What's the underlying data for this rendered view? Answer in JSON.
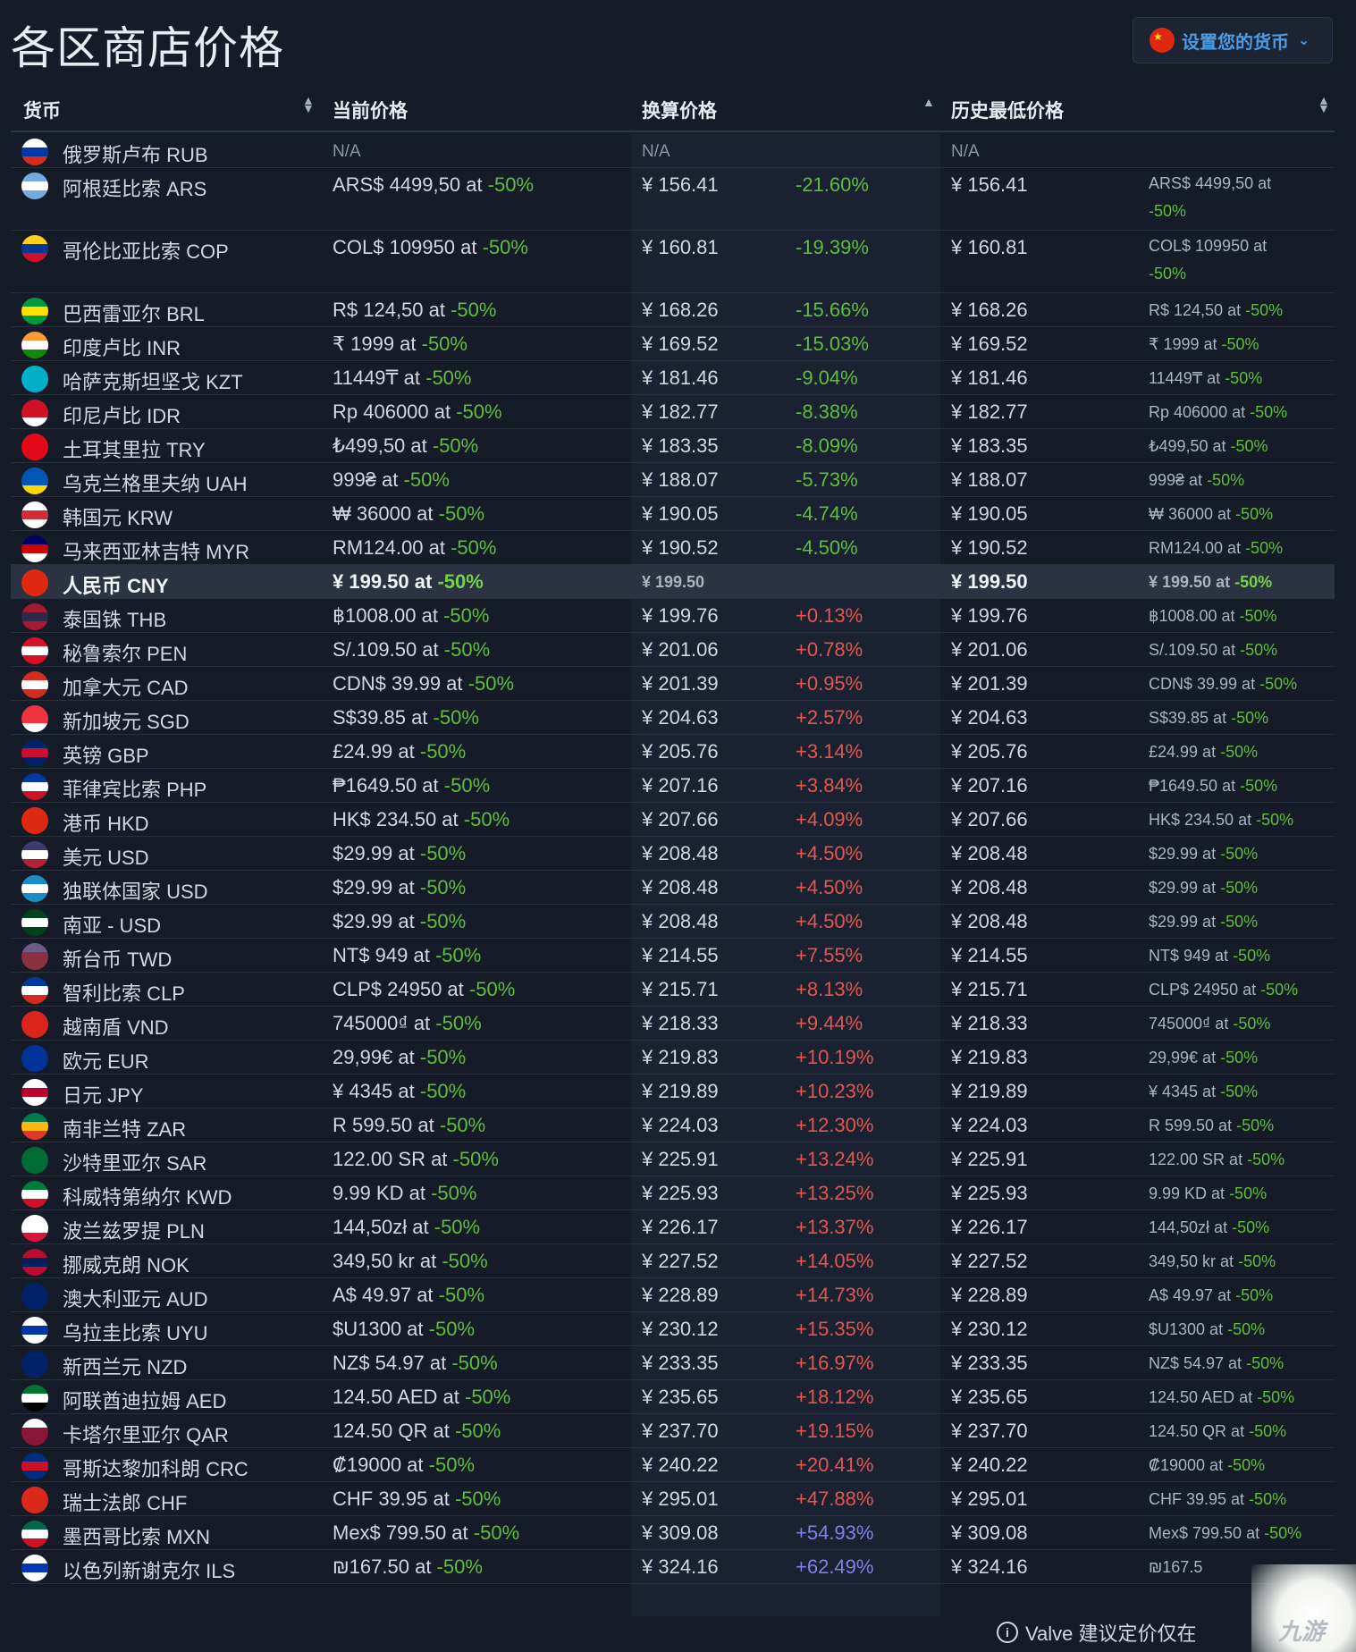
{
  "title": "各区商店价格",
  "currency_button": "设置您的货币",
  "columns": {
    "currency": "货币",
    "current": "当前价格",
    "converted": "换算价格",
    "lowest": "历史最低价格"
  },
  "footer": "Valve 建议定价仅在",
  "watermark": "九游",
  "rows": [
    {
      "name": "俄罗斯卢布 RUB",
      "cur": "N/A",
      "conv": "N/A",
      "pct": "",
      "low": "N/A",
      "low_p": "",
      "low_d": "",
      "na": true,
      "colors": [
        "#ffffff",
        "#0039a6",
        "#d52b1e"
      ]
    },
    {
      "name": "阿根廷比索 ARS",
      "cur_p": "ARS$ 4499,50 at ",
      "cur_d": "-50%",
      "conv": "¥ 156.41",
      "pct": "-21.60%",
      "low": "¥ 156.41",
      "low_p": "ARS$ 4499,50 at ",
      "low_d": "-50%",
      "tall": true,
      "colors": [
        "#74acdf",
        "#ffffff",
        "#74acdf"
      ]
    },
    {
      "name": "哥伦比亚比索 COP",
      "cur_p": "COL$ 109950 at ",
      "cur_d": "-50%",
      "conv": "¥ 160.81",
      "pct": "-19.39%",
      "low": "¥ 160.81",
      "low_p": "COL$ 109950 at ",
      "low_d": "-50%",
      "tall": true,
      "colors": [
        "#fcd116",
        "#003893",
        "#ce1126"
      ]
    },
    {
      "name": "巴西雷亚尔 BRL",
      "cur_p": "R$ 124,50 at ",
      "cur_d": "-50%",
      "conv": "¥ 168.26",
      "pct": "-15.66%",
      "low": "¥ 168.26",
      "low_p": "R$ 124,50 at ",
      "low_d": "-50%",
      "colors": [
        "#009c3b",
        "#ffdf00",
        "#009c3b"
      ]
    },
    {
      "name": "印度卢比 INR",
      "cur_p": "₹ 1999 at ",
      "cur_d": "-50%",
      "conv": "¥ 169.52",
      "pct": "-15.03%",
      "low": "¥ 169.52",
      "low_p": "₹ 1999 at ",
      "low_d": "-50%",
      "colors": [
        "#ff9933",
        "#ffffff",
        "#138808"
      ]
    },
    {
      "name": "哈萨克斯坦坚戈 KZT",
      "cur_p": "11449₸ at ",
      "cur_d": "-50%",
      "conv": "¥ 181.46",
      "pct": "-9.04%",
      "low": "¥ 181.46",
      "low_p": "11449₸ at ",
      "low_d": "-50%",
      "colors": [
        "#00afca",
        "#00afca",
        "#00afca"
      ]
    },
    {
      "name": "印尼卢比 IDR",
      "cur_p": "Rp 406000 at ",
      "cur_d": "-50%",
      "conv": "¥ 182.77",
      "pct": "-8.38%",
      "low": "¥ 182.77",
      "low_p": "Rp 406000 at ",
      "low_d": "-50%",
      "colors": [
        "#ce1126",
        "#ce1126",
        "#ffffff"
      ]
    },
    {
      "name": "土耳其里拉 TRY",
      "cur_p": "₺499,50 at ",
      "cur_d": "-50%",
      "conv": "¥ 183.35",
      "pct": "-8.09%",
      "low": "¥ 183.35",
      "low_p": "₺499,50 at ",
      "low_d": "-50%",
      "colors": [
        "#e30a17",
        "#e30a17",
        "#e30a17"
      ]
    },
    {
      "name": "乌克兰格里夫纳 UAH",
      "cur_p": "999₴ at ",
      "cur_d": "-50%",
      "conv": "¥ 188.07",
      "pct": "-5.73%",
      "low": "¥ 188.07",
      "low_p": "999₴ at ",
      "low_d": "-50%",
      "colors": [
        "#0057b7",
        "#0057b7",
        "#ffd700"
      ]
    },
    {
      "name": "韩国元 KRW",
      "cur_p": "₩ 36000 at ",
      "cur_d": "-50%",
      "conv": "¥ 190.05",
      "pct": "-4.74%",
      "low": "¥ 190.05",
      "low_p": "₩ 36000 at ",
      "low_d": "-50%",
      "colors": [
        "#ffffff",
        "#cd2e3a",
        "#ffffff"
      ]
    },
    {
      "name": "马来西亚林吉特 MYR",
      "cur_p": "RM124.00 at ",
      "cur_d": "-50%",
      "conv": "¥ 190.52",
      "pct": "-4.50%",
      "low": "¥ 190.52",
      "low_p": "RM124.00 at ",
      "low_d": "-50%",
      "colors": [
        "#010066",
        "#cc0001",
        "#ffffff"
      ]
    },
    {
      "name": "人民币 CNY",
      "cur_p": "¥ 199.50 at ",
      "cur_d": "-50%",
      "conv": "¥ 199.50",
      "pct": "",
      "low": "¥ 199.50",
      "low_p": "¥ 199.50 at ",
      "low_d": "-50%",
      "hl": true,
      "colors": [
        "#de2910",
        "#de2910",
        "#de2910"
      ]
    },
    {
      "name": "泰国铢 THB",
      "cur_p": "฿1008.00 at ",
      "cur_d": "-50%",
      "conv": "¥ 199.76",
      "pct": "+0.13%",
      "low": "¥ 199.76",
      "low_p": "฿1008.00 at ",
      "low_d": "-50%",
      "colors": [
        "#a51931",
        "#2d2a4a",
        "#a51931"
      ]
    },
    {
      "name": "秘鲁索尔 PEN",
      "cur_p": "S/.109.50 at ",
      "cur_d": "-50%",
      "conv": "¥ 201.06",
      "pct": "+0.78%",
      "low": "¥ 201.06",
      "low_p": "S/.109.50 at ",
      "low_d": "-50%",
      "colors": [
        "#d91023",
        "#ffffff",
        "#d91023"
      ]
    },
    {
      "name": "加拿大元 CAD",
      "cur_p": "CDN$ 39.99 at ",
      "cur_d": "-50%",
      "conv": "¥ 201.39",
      "pct": "+0.95%",
      "low": "¥ 201.39",
      "low_p": "CDN$ 39.99 at ",
      "low_d": "-50%",
      "colors": [
        "#d52b1e",
        "#ffffff",
        "#d52b1e"
      ]
    },
    {
      "name": "新加坡元 SGD",
      "cur_p": "S$39.85 at ",
      "cur_d": "-50%",
      "conv": "¥ 204.63",
      "pct": "+2.57%",
      "low": "¥ 204.63",
      "low_p": "S$39.85 at ",
      "low_d": "-50%",
      "colors": [
        "#ef3340",
        "#ef3340",
        "#ffffff"
      ]
    },
    {
      "name": "英镑 GBP",
      "cur_p": "£24.99 at ",
      "cur_d": "-50%",
      "conv": "¥ 205.76",
      "pct": "+3.14%",
      "low": "¥ 205.76",
      "low_p": "£24.99 at ",
      "low_d": "-50%",
      "colors": [
        "#012169",
        "#c8102e",
        "#012169"
      ]
    },
    {
      "name": "菲律宾比索 PHP",
      "cur_p": "₱1649.50 at ",
      "cur_d": "-50%",
      "conv": "¥ 207.16",
      "pct": "+3.84%",
      "low": "¥ 207.16",
      "low_p": "₱1649.50 at ",
      "low_d": "-50%",
      "colors": [
        "#0038a8",
        "#ffffff",
        "#ce1126"
      ]
    },
    {
      "name": "港币 HKD",
      "cur_p": "HK$ 234.50 at ",
      "cur_d": "-50%",
      "conv": "¥ 207.66",
      "pct": "+4.09%",
      "low": "¥ 207.66",
      "low_p": "HK$ 234.50 at ",
      "low_d": "-50%",
      "colors": [
        "#de2910",
        "#de2910",
        "#de2910"
      ]
    },
    {
      "name": "美元 USD",
      "cur_p": "$29.99 at ",
      "cur_d": "-50%",
      "conv": "¥ 208.48",
      "pct": "+4.50%",
      "low": "¥ 208.48",
      "low_p": "$29.99 at ",
      "low_d": "-50%",
      "colors": [
        "#3c3b6e",
        "#ffffff",
        "#b22234"
      ]
    },
    {
      "name": "独联体国家 USD",
      "cur_p": "$29.99 at ",
      "cur_d": "-50%",
      "conv": "¥ 208.48",
      "pct": "+4.50%",
      "low": "¥ 208.48",
      "low_p": "$29.99 at ",
      "low_d": "-50%",
      "colors": [
        "#1b8dc6",
        "#ffffff",
        "#1b8dc6"
      ]
    },
    {
      "name": "南亚 - USD",
      "cur_p": "$29.99 at ",
      "cur_d": "-50%",
      "conv": "¥ 208.48",
      "pct": "+4.50%",
      "low": "¥ 208.48",
      "low_p": "$29.99 at ",
      "low_d": "-50%",
      "colors": [
        "#01411c",
        "#ffffff",
        "#01411c"
      ]
    },
    {
      "name": "新台币 TWD",
      "cur_p": "NT$ 949 at ",
      "cur_d": "-50%",
      "conv": "¥ 214.55",
      "pct": "+7.55%",
      "low": "¥ 214.55",
      "low_p": "NT$ 949 at ",
      "low_d": "-50%",
      "colors": [
        "#6b5a8a",
        "#8a3040",
        "#8a3040"
      ]
    },
    {
      "name": "智利比索 CLP",
      "cur_p": "CLP$ 24950 at ",
      "cur_d": "-50%",
      "conv": "¥ 215.71",
      "pct": "+8.13%",
      "low": "¥ 215.71",
      "low_p": "CLP$ 24950 at ",
      "low_d": "-50%",
      "colors": [
        "#0039a6",
        "#ffffff",
        "#d52b1e"
      ]
    },
    {
      "name": "越南盾 VND",
      "cur_p": "745000₫ at ",
      "cur_d": "-50%",
      "conv": "¥ 218.33",
      "pct": "+9.44%",
      "low": "¥ 218.33",
      "low_p": "745000₫ at ",
      "low_d": "-50%",
      "colors": [
        "#da251d",
        "#da251d",
        "#da251d"
      ]
    },
    {
      "name": "欧元 EUR",
      "cur_p": "29,99€ at ",
      "cur_d": "-50%",
      "conv": "¥ 219.83",
      "pct": "+10.19%",
      "low": "¥ 219.83",
      "low_p": "29,99€ at ",
      "low_d": "-50%",
      "colors": [
        "#003399",
        "#003399",
        "#003399"
      ]
    },
    {
      "name": "日元 JPY",
      "cur_p": "¥ 4345 at ",
      "cur_d": "-50%",
      "conv": "¥ 219.89",
      "pct": "+10.23%",
      "low": "¥ 219.89",
      "low_p": "¥ 4345 at ",
      "low_d": "-50%",
      "colors": [
        "#ffffff",
        "#bc002d",
        "#ffffff"
      ]
    },
    {
      "name": "南非兰特 ZAR",
      "cur_p": "R 599.50 at ",
      "cur_d": "-50%",
      "conv": "¥ 224.03",
      "pct": "+12.30%",
      "low": "¥ 224.03",
      "low_p": "R 599.50 at ",
      "low_d": "-50%",
      "colors": [
        "#007a4d",
        "#ffb612",
        "#de3831"
      ]
    },
    {
      "name": "沙特里亚尔 SAR",
      "cur_p": "122.00 SR at ",
      "cur_d": "-50%",
      "conv": "¥ 225.91",
      "pct": "+13.24%",
      "low": "¥ 225.91",
      "low_p": "122.00 SR at ",
      "low_d": "-50%",
      "colors": [
        "#006c35",
        "#006c35",
        "#006c35"
      ]
    },
    {
      "name": "科威特第纳尔 KWD",
      "cur_p": "9.99 KD at ",
      "cur_d": "-50%",
      "conv": "¥ 225.93",
      "pct": "+13.25%",
      "low": "¥ 225.93",
      "low_p": "9.99 KD at ",
      "low_d": "-50%",
      "colors": [
        "#007a3d",
        "#ffffff",
        "#ce1126"
      ]
    },
    {
      "name": "波兰兹罗提 PLN",
      "cur_p": "144,50zł at ",
      "cur_d": "-50%",
      "conv": "¥ 226.17",
      "pct": "+13.37%",
      "low": "¥ 226.17",
      "low_p": "144,50zł at ",
      "low_d": "-50%",
      "colors": [
        "#ffffff",
        "#ffffff",
        "#dc143c"
      ]
    },
    {
      "name": "挪威克朗 NOK",
      "cur_p": "349,50 kr at ",
      "cur_d": "-50%",
      "conv": "¥ 227.52",
      "pct": "+14.05%",
      "low": "¥ 227.52",
      "low_p": "349,50 kr at ",
      "low_d": "-50%",
      "colors": [
        "#ba0c2f",
        "#00205b",
        "#ba0c2f"
      ]
    },
    {
      "name": "澳大利亚元 AUD",
      "cur_p": "A$ 49.97 at ",
      "cur_d": "-50%",
      "conv": "¥ 228.89",
      "pct": "+14.73%",
      "low": "¥ 228.89",
      "low_p": "A$ 49.97 at ",
      "low_d": "-50%",
      "colors": [
        "#012169",
        "#012169",
        "#012169"
      ]
    },
    {
      "name": "乌拉圭比索 UYU",
      "cur_p": "$U1300 at ",
      "cur_d": "-50%",
      "conv": "¥ 230.12",
      "pct": "+15.35%",
      "low": "¥ 230.12",
      "low_p": "$U1300 at ",
      "low_d": "-50%",
      "colors": [
        "#ffffff",
        "#0038a8",
        "#ffffff"
      ]
    },
    {
      "name": "新西兰元 NZD",
      "cur_p": "NZ$ 54.97 at ",
      "cur_d": "-50%",
      "conv": "¥ 233.35",
      "pct": "+16.97%",
      "low": "¥ 233.35",
      "low_p": "NZ$ 54.97 at ",
      "low_d": "-50%",
      "colors": [
        "#012169",
        "#012169",
        "#012169"
      ]
    },
    {
      "name": "阿联酋迪拉姆 AED",
      "cur_p": "124.50 AED at ",
      "cur_d": "-50%",
      "conv": "¥ 235.65",
      "pct": "+18.12%",
      "low": "¥ 235.65",
      "low_p": "124.50 AED at ",
      "low_d": "-50%",
      "colors": [
        "#00732f",
        "#ffffff",
        "#000000"
      ]
    },
    {
      "name": "卡塔尔里亚尔 QAR",
      "cur_p": "124.50 QR at ",
      "cur_d": "-50%",
      "conv": "¥ 237.70",
      "pct": "+19.15%",
      "low": "¥ 237.70",
      "low_p": "124.50 QR at ",
      "low_d": "-50%",
      "colors": [
        "#ffffff",
        "#8a1538",
        "#8a1538"
      ]
    },
    {
      "name": "哥斯达黎加科朗 CRC",
      "cur_p": "₡19000 at ",
      "cur_d": "-50%",
      "conv": "¥ 240.22",
      "pct": "+20.41%",
      "low": "¥ 240.22",
      "low_p": "₡19000 at ",
      "low_d": "-50%",
      "colors": [
        "#002b7f",
        "#ce1126",
        "#002b7f"
      ]
    },
    {
      "name": "瑞士法郎 CHF",
      "cur_p": "CHF 39.95 at ",
      "cur_d": "-50%",
      "conv": "¥ 295.01",
      "pct": "+47.88%",
      "low": "¥ 295.01",
      "low_p": "CHF 39.95 at ",
      "low_d": "-50%",
      "colors": [
        "#da291c",
        "#da291c",
        "#da291c"
      ]
    },
    {
      "name": "墨西哥比索 MXN",
      "cur_p": "Mex$ 799.50 at ",
      "cur_d": "-50%",
      "conv": "¥ 309.08",
      "pct": "+54.93%",
      "low": "¥ 309.08",
      "low_p": "Mex$ 799.50 at ",
      "low_d": "-50%",
      "blue": true,
      "colors": [
        "#006847",
        "#ffffff",
        "#ce1126"
      ]
    },
    {
      "name": "以色列新谢克尔 ILS",
      "cur_p": "₪167.50 at ",
      "cur_d": "-50%",
      "conv": "¥ 324.16",
      "pct": "+62.49%",
      "low": "¥ 324.16",
      "low_p": "₪167.5",
      "low_d": "",
      "blue": true,
      "colors": [
        "#ffffff",
        "#0038b8",
        "#ffffff"
      ]
    }
  ]
}
